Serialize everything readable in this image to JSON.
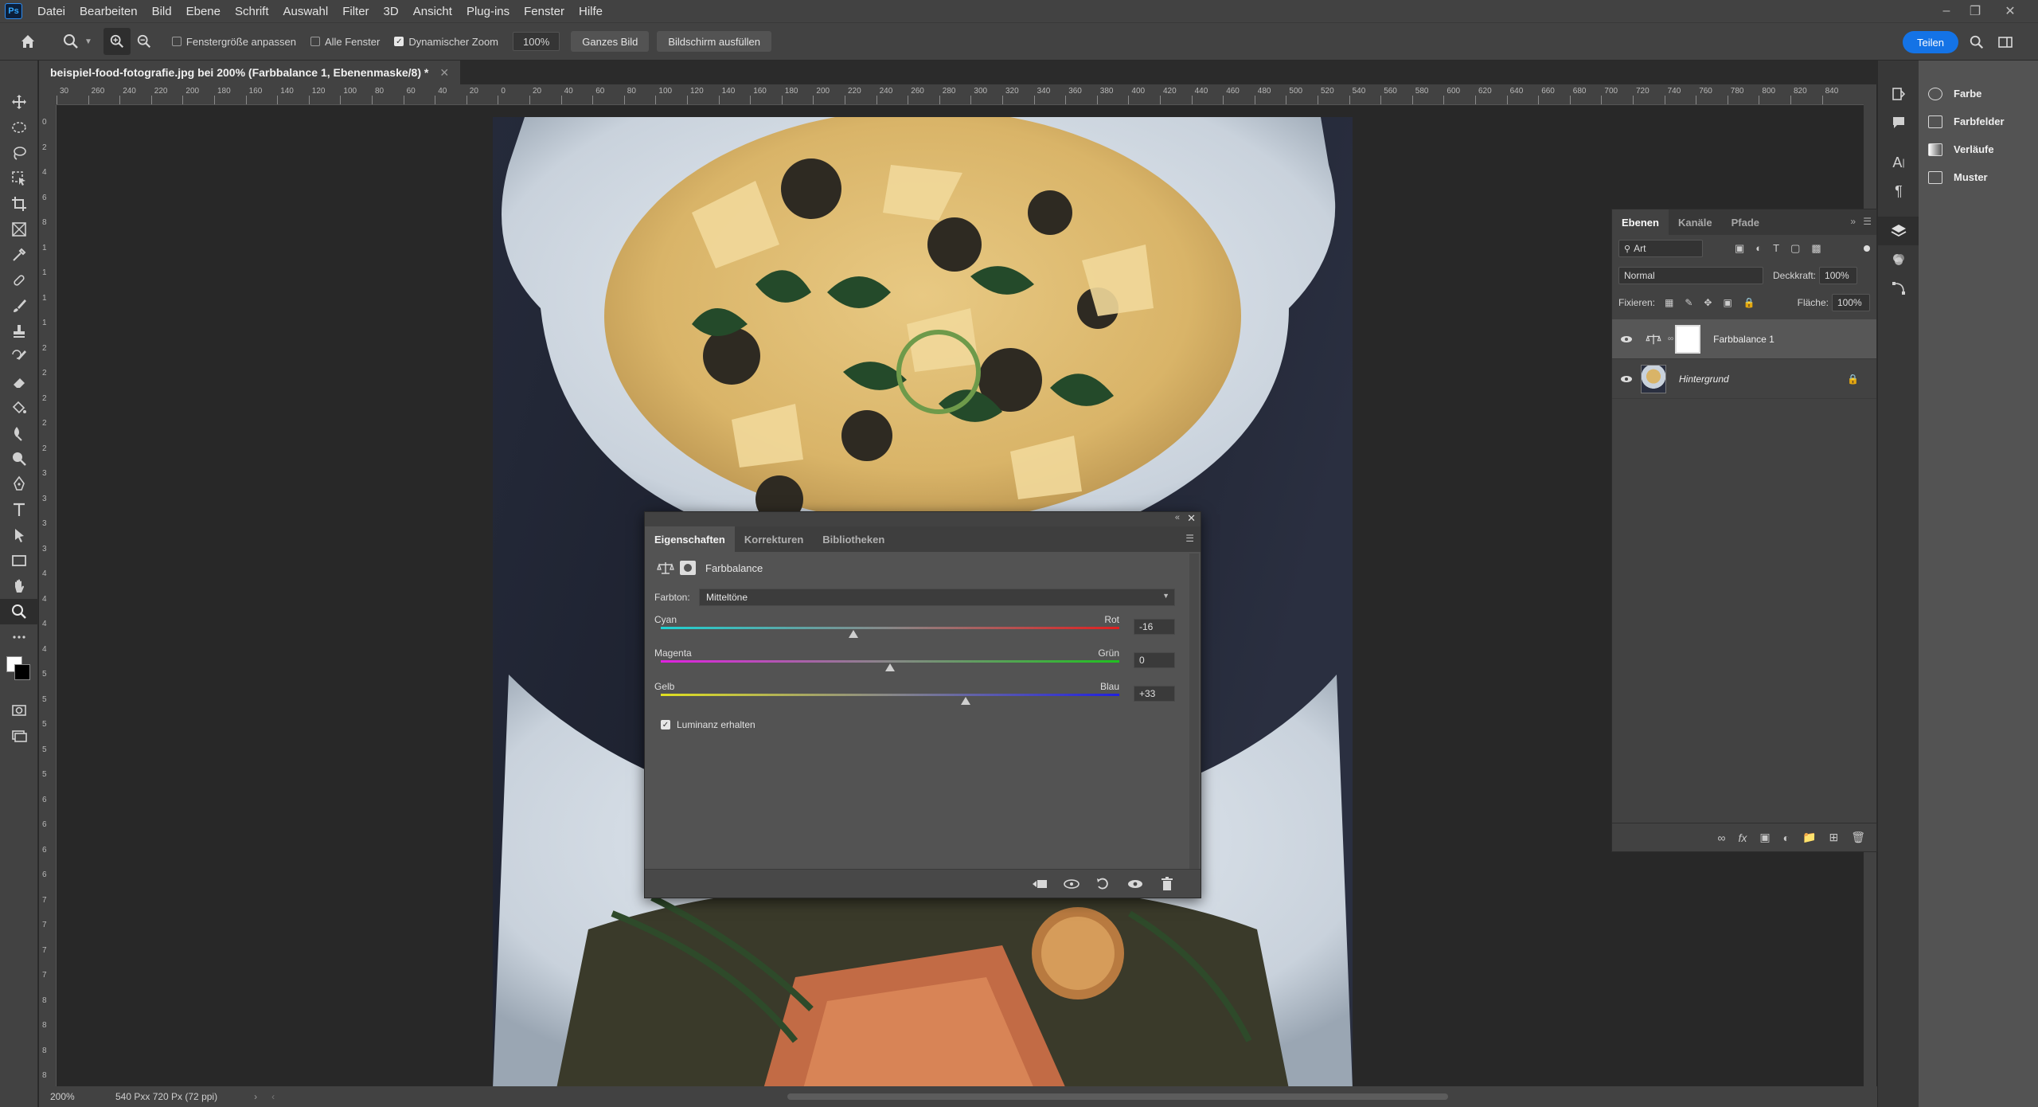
{
  "menubar": {
    "logo": "Ps",
    "items": [
      "Datei",
      "Bearbeiten",
      "Bild",
      "Ebene",
      "Schrift",
      "Auswahl",
      "Filter",
      "3D",
      "Ansicht",
      "Plug-ins",
      "Fenster",
      "Hilfe"
    ]
  },
  "options": {
    "fit_window": "Fenstergröße anpassen",
    "all_windows": "Alle Fenster",
    "dynamic_zoom": "Dynamischer Zoom",
    "zoom_value": "100%",
    "fit_screen": "Ganzes Bild",
    "fill_screen": "Bildschirm ausfüllen",
    "share": "Teilen"
  },
  "document": {
    "tab_title": "beispiel-food-fotografie.jpg bei 200% (Farbbalance 1, Ebenenmaske/8) *",
    "zoom": "200%",
    "size": "540 Pxx 720 Px (72 ppi)"
  },
  "ruler": {
    "h_labels": [
      "30",
      "260",
      "240",
      "220",
      "200",
      "180",
      "160",
      "140",
      "120",
      "100",
      "80",
      "60",
      "40",
      "20",
      "0",
      "20",
      "40",
      "60",
      "80",
      "100",
      "120",
      "140",
      "160",
      "180",
      "200",
      "220",
      "240",
      "260",
      "280",
      "300",
      "320",
      "340",
      "360",
      "380",
      "400",
      "420",
      "440",
      "460",
      "480",
      "500",
      "520",
      "540",
      "560",
      "580",
      "600",
      "620",
      "640",
      "660",
      "680",
      "700",
      "720",
      "740",
      "760",
      "780",
      "800",
      "820",
      "840"
    ],
    "v_labels": [
      "0",
      "2",
      "4",
      "6",
      "8",
      "1",
      "1",
      "1",
      "1",
      "2",
      "2",
      "2",
      "2",
      "2",
      "3",
      "3",
      "3",
      "3",
      "4",
      "4",
      "4",
      "4",
      "5",
      "5",
      "5",
      "5",
      "5",
      "6",
      "6",
      "6",
      "6",
      "7",
      "7",
      "7",
      "7",
      "8",
      "8",
      "8",
      "8"
    ]
  },
  "right_panels": {
    "items": [
      "Farbe",
      "Farbfelder",
      "Verläufe",
      "Muster"
    ]
  },
  "layers": {
    "tabs": [
      "Ebenen",
      "Kanäle",
      "Pfade"
    ],
    "filter_label": "Art",
    "blend_mode": "Normal",
    "opacity_label": "Deckkraft:",
    "opacity_value": "100%",
    "lock_label": "Fixieren:",
    "fill_label": "Fläche:",
    "fill_value": "100%",
    "list": [
      {
        "name": "Farbbalance 1"
      },
      {
        "name": "Hintergrund"
      }
    ]
  },
  "properties": {
    "tabs": [
      "Eigenschaften",
      "Korrekturen",
      "Bibliotheken"
    ],
    "title": "Farbbalance",
    "tone_label": "Farbton:",
    "tone_value": "Mitteltöne",
    "sliders": [
      {
        "left": "Cyan",
        "right": "Rot",
        "value": "-16",
        "pos": -16
      },
      {
        "left": "Magenta",
        "right": "Grün",
        "value": "0",
        "pos": 0
      },
      {
        "left": "Gelb",
        "right": "Blau",
        "value": "+33",
        "pos": 33
      }
    ],
    "preserve_luminosity": "Luminanz erhalten"
  },
  "colors": {
    "accent": "#1473e6",
    "panel_bg": "#535353"
  }
}
